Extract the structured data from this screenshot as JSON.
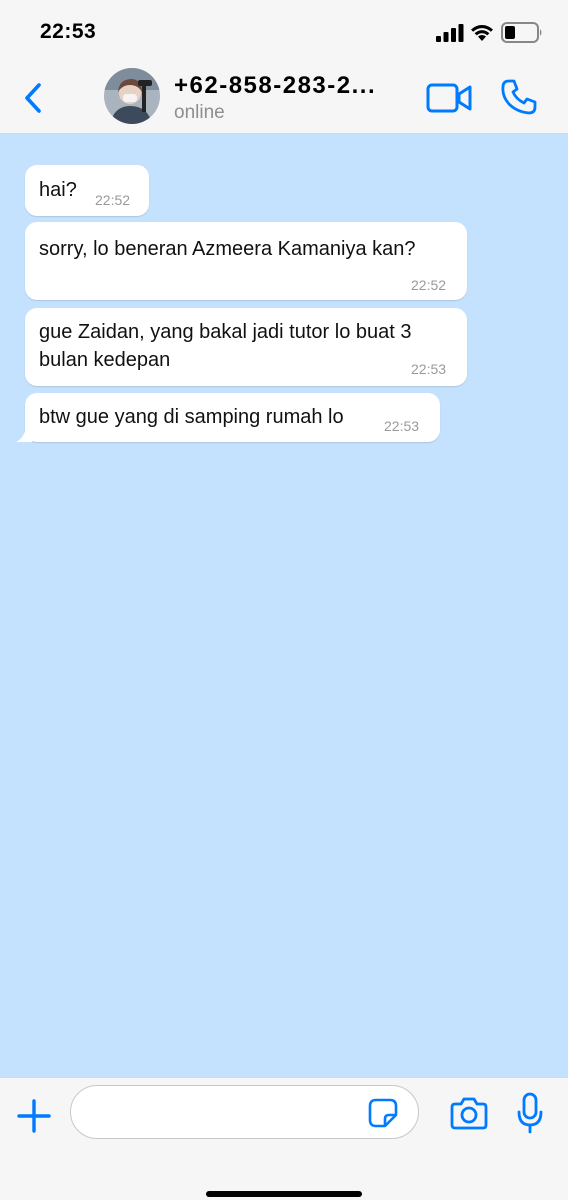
{
  "status_bar": {
    "time": "22:53"
  },
  "header": {
    "contact_name": "+62-858-283-2...",
    "contact_status": "online",
    "back_icon": "chevron-left-icon",
    "video_icon": "video-camera-icon",
    "call_icon": "phone-icon"
  },
  "messages": [
    {
      "text": "hai?",
      "time": "22:52"
    },
    {
      "text": "sorry, lo beneran Azmeera Kamaniya kan?",
      "time": "22:52"
    },
    {
      "text_line1": "gue Zaidan, yang bakal jadi tutor lo buat 3",
      "text_line2": "bulan kedepan",
      "time": "22:53"
    },
    {
      "text": "btw gue yang di samping rumah lo",
      "time": "22:53"
    }
  ],
  "input_bar": {
    "message_value": "",
    "icons": [
      "plus-icon",
      "sticker-icon",
      "camera-icon",
      "microphone-icon"
    ]
  },
  "colors": {
    "accent": "#007aff",
    "chat_background": "#c4e1fd",
    "bubble": "#ffffff"
  }
}
